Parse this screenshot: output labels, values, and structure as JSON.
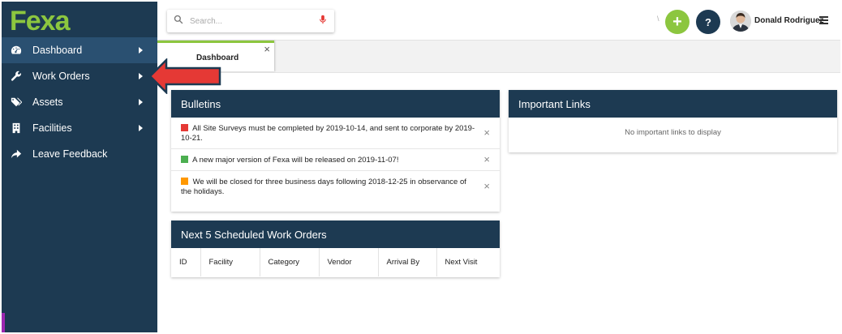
{
  "brand": {
    "logo_text": "Fexa",
    "accent": "#8cc63f",
    "navy": "#1d3a52"
  },
  "sidebar": {
    "items": [
      {
        "label": "Dashboard",
        "icon": "dashboard-gauge-icon",
        "active": true
      },
      {
        "label": "Work Orders",
        "icon": "wrench-icon"
      },
      {
        "label": "Assets",
        "icon": "tags-icon"
      },
      {
        "label": "Facilities",
        "icon": "building-icon"
      },
      {
        "label": "Leave Feedback",
        "icon": "share-arrow-icon"
      }
    ]
  },
  "header": {
    "search_placeholder": "Search...",
    "add_label": "+",
    "help_label": "?",
    "user_name": "Donald Rodriguez"
  },
  "tabs": [
    {
      "label": "Dashboard",
      "close": "×"
    }
  ],
  "bulletins": {
    "title": "Bulletins",
    "items": [
      {
        "color": "#e53935",
        "text": "All Site Surveys must be completed by 2019-10-14, and sent to corporate by 2019-10-21."
      },
      {
        "color": "#4caf50",
        "text": "A new major version of Fexa will be released on 2019-11-07!"
      },
      {
        "color": "#ff9800",
        "text": "We will be closed for three business days following 2018-12-25 in observance of the holidays."
      }
    ],
    "close": "×"
  },
  "important_links": {
    "title": "Important Links",
    "empty_message": "No important links to display"
  },
  "work_orders": {
    "title": "Next 5 Scheduled Work Orders",
    "columns": [
      "ID",
      "Facility",
      "Category",
      "Vendor",
      "Arrival By",
      "Next Visit"
    ]
  },
  "annotation": {
    "arrow_color": "#e53935"
  }
}
